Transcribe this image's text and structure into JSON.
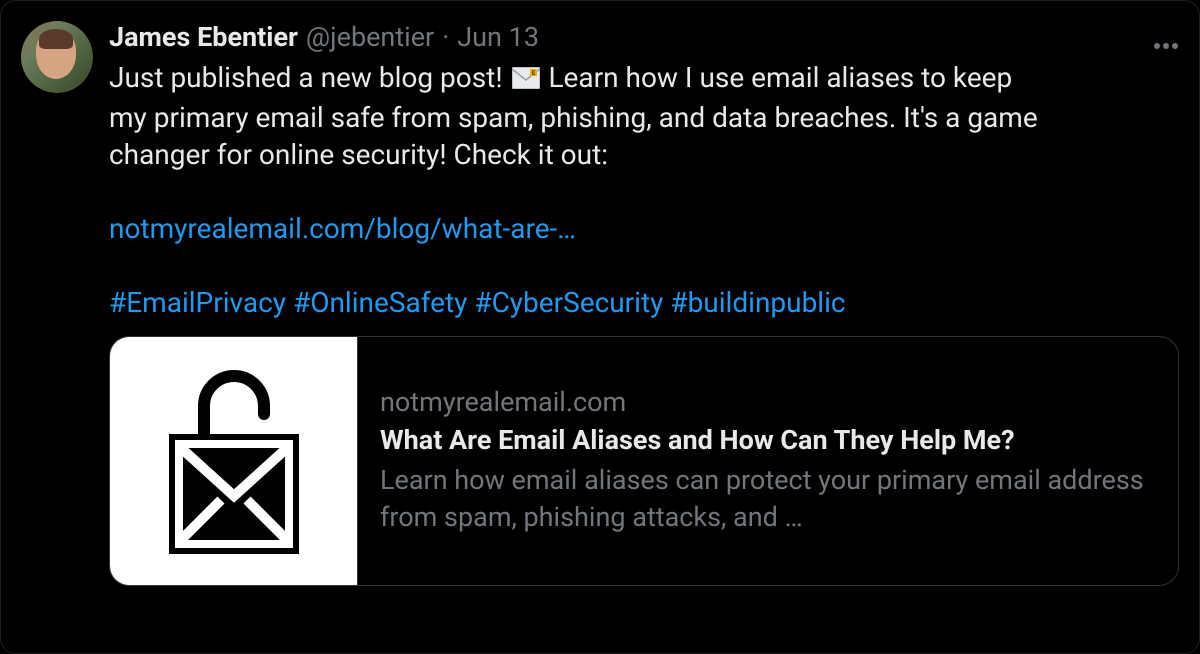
{
  "tweet": {
    "author": {
      "name": "James Ebentier",
      "handle": "@jebentier"
    },
    "date": "Jun 13",
    "separator": "·",
    "text_line1_a": "Just published a new blog post! ",
    "text_line1_b": " Learn how I use email aliases to keep",
    "text_line2": "my primary email safe from spam, phishing, and data breaches. It's a game",
    "text_line3": "changer for online security! Check it out:",
    "link_text": "notmyrealemail.com/blog/what-are-…",
    "hashtags": {
      "h1": "#EmailPrivacy",
      "h2": "#OnlineSafety",
      "h3": "#CyberSecurity",
      "h4": "#buildinpublic"
    },
    "card": {
      "domain": "notmyrealemail.com",
      "title": "What Are Email Aliases and How Can They Help Me?",
      "description": "Learn how email aliases can protect your primary email address from spam, phishing attacks, and …"
    }
  }
}
